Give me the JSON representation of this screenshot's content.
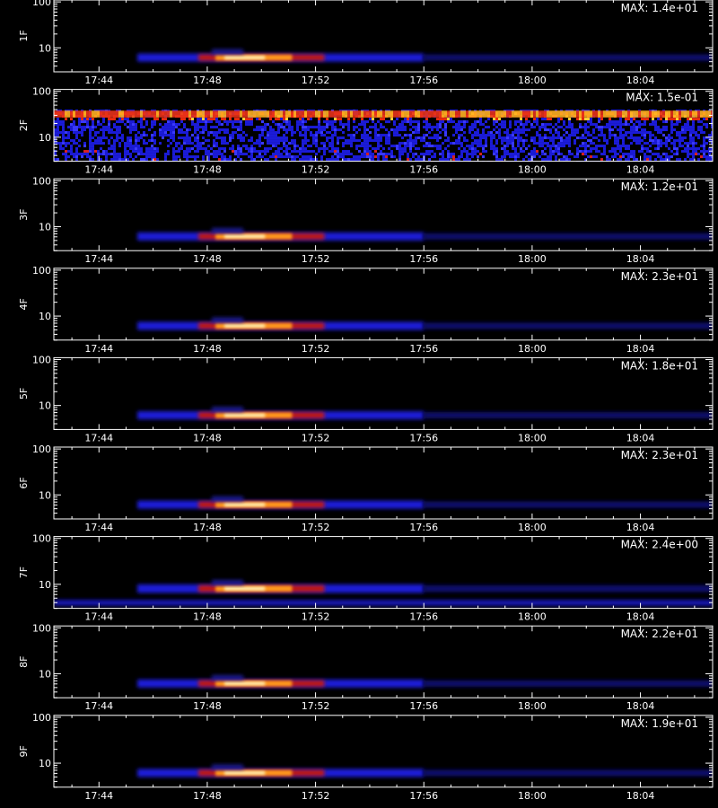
{
  "chart_data": [
    {
      "type": "heatmap",
      "ylabel": "1F",
      "max_label": "MAX: 1.4e+01",
      "yticks": [
        "100",
        "10"
      ],
      "xticks": [
        "17:44",
        "17:48",
        "17:52",
        "17:56",
        "18:00",
        "18:04"
      ],
      "scale": "log",
      "ylim": [
        3,
        110
      ],
      "burst": {
        "start": "17:45:25",
        "peak_start": "17:48:30",
        "peak_end": "17:51:00",
        "fade_end": "17:56:00",
        "energy_lo": 5,
        "energy_hi": 7.5
      }
    },
    {
      "type": "heatmap",
      "ylabel": "2F",
      "max_label": "MAX: 1.5e-01",
      "yticks": [
        "100",
        "10"
      ],
      "xticks": [
        "17:44",
        "17:48",
        "17:52",
        "17:56",
        "18:00",
        "18:04"
      ],
      "scale": "log",
      "ylim": [
        3,
        110
      ],
      "noise": true
    },
    {
      "type": "heatmap",
      "ylabel": "3F",
      "max_label": "MAX: 1.2e+01",
      "yticks": [
        "100",
        "10"
      ],
      "xticks": [
        "17:44",
        "17:48",
        "17:52",
        "17:56",
        "18:00",
        "18:04"
      ],
      "scale": "log",
      "ylim": [
        3,
        110
      ],
      "burst": {
        "start": "17:45:25",
        "peak_start": "17:48:30",
        "peak_end": "17:51:00",
        "fade_end": "17:56:00",
        "energy_lo": 5,
        "energy_hi": 7.5
      }
    },
    {
      "type": "heatmap",
      "ylabel": "4F",
      "max_label": "MAX: 2.3e+01",
      "yticks": [
        "100",
        "10"
      ],
      "xticks": [
        "17:44",
        "17:48",
        "17:52",
        "17:56",
        "18:00",
        "18:04"
      ],
      "scale": "log",
      "ylim": [
        3,
        110
      ],
      "burst": {
        "start": "17:45:25",
        "peak_start": "17:48:30",
        "peak_end": "17:51:00",
        "fade_end": "17:56:00",
        "energy_lo": 5,
        "energy_hi": 7.5
      }
    },
    {
      "type": "heatmap",
      "ylabel": "5F",
      "max_label": "MAX: 1.8e+01",
      "yticks": [
        "100",
        "10"
      ],
      "xticks": [
        "17:44",
        "17:48",
        "17:52",
        "17:56",
        "18:00",
        "18:04"
      ],
      "scale": "log",
      "ylim": [
        3,
        110
      ],
      "burst": {
        "start": "17:45:25",
        "peak_start": "17:48:30",
        "peak_end": "17:51:00",
        "fade_end": "17:56:00",
        "energy_lo": 5,
        "energy_hi": 7.5
      }
    },
    {
      "type": "heatmap",
      "ylabel": "6F",
      "max_label": "MAX: 2.3e+01",
      "yticks": [
        "100",
        "10"
      ],
      "xticks": [
        "17:44",
        "17:48",
        "17:52",
        "17:56",
        "18:00",
        "18:04"
      ],
      "scale": "log",
      "ylim": [
        3,
        110
      ],
      "burst": {
        "start": "17:45:25",
        "peak_start": "17:48:30",
        "peak_end": "17:51:00",
        "fade_end": "17:56:00",
        "energy_lo": 5,
        "energy_hi": 7.5
      }
    },
    {
      "type": "heatmap",
      "ylabel": "7F",
      "max_label": "MAX: 2.4e+00",
      "yticks": [
        "100",
        "10"
      ],
      "xticks": [
        "17:44",
        "17:48",
        "17:52",
        "17:56",
        "18:00",
        "18:04"
      ],
      "scale": "log",
      "ylim": [
        3,
        110
      ],
      "burst": {
        "start": "17:45:25",
        "peak_start": "17:48:30",
        "peak_end": "17:51:00",
        "fade_end": "17:56:00",
        "energy_lo": 6.5,
        "energy_hi": 10
      }
    },
    {
      "type": "heatmap",
      "ylabel": "8F",
      "max_label": "MAX: 2.2e+01",
      "yticks": [
        "100",
        "10"
      ],
      "xticks": [
        "17:44",
        "17:48",
        "17:52",
        "17:56",
        "18:00",
        "18:04"
      ],
      "scale": "log",
      "ylim": [
        3,
        110
      ],
      "burst": {
        "start": "17:45:25",
        "peak_start": "17:48:30",
        "peak_end": "17:51:00",
        "fade_end": "17:56:00",
        "energy_lo": 5,
        "energy_hi": 7.5
      }
    },
    {
      "type": "heatmap",
      "ylabel": "9F",
      "max_label": "MAX: 1.9e+01",
      "yticks": [
        "100",
        "10"
      ],
      "xticks": [
        "17:44",
        "17:48",
        "17:52",
        "17:56",
        "18:00",
        "18:04"
      ],
      "scale": "log",
      "ylim": [
        3,
        110
      ],
      "burst": {
        "start": "17:45:25",
        "peak_start": "17:48:30",
        "peak_end": "17:51:00",
        "fade_end": "17:56:00",
        "energy_lo": 5,
        "energy_hi": 7.5
      }
    }
  ],
  "time_range": {
    "start": "17:42:20",
    "end": "18:06:40"
  },
  "colors": {
    "background": "#000000",
    "axis": "#ffffff",
    "low": "#1a1aff",
    "mid": "#ff2a00",
    "high": "#fffff0"
  }
}
